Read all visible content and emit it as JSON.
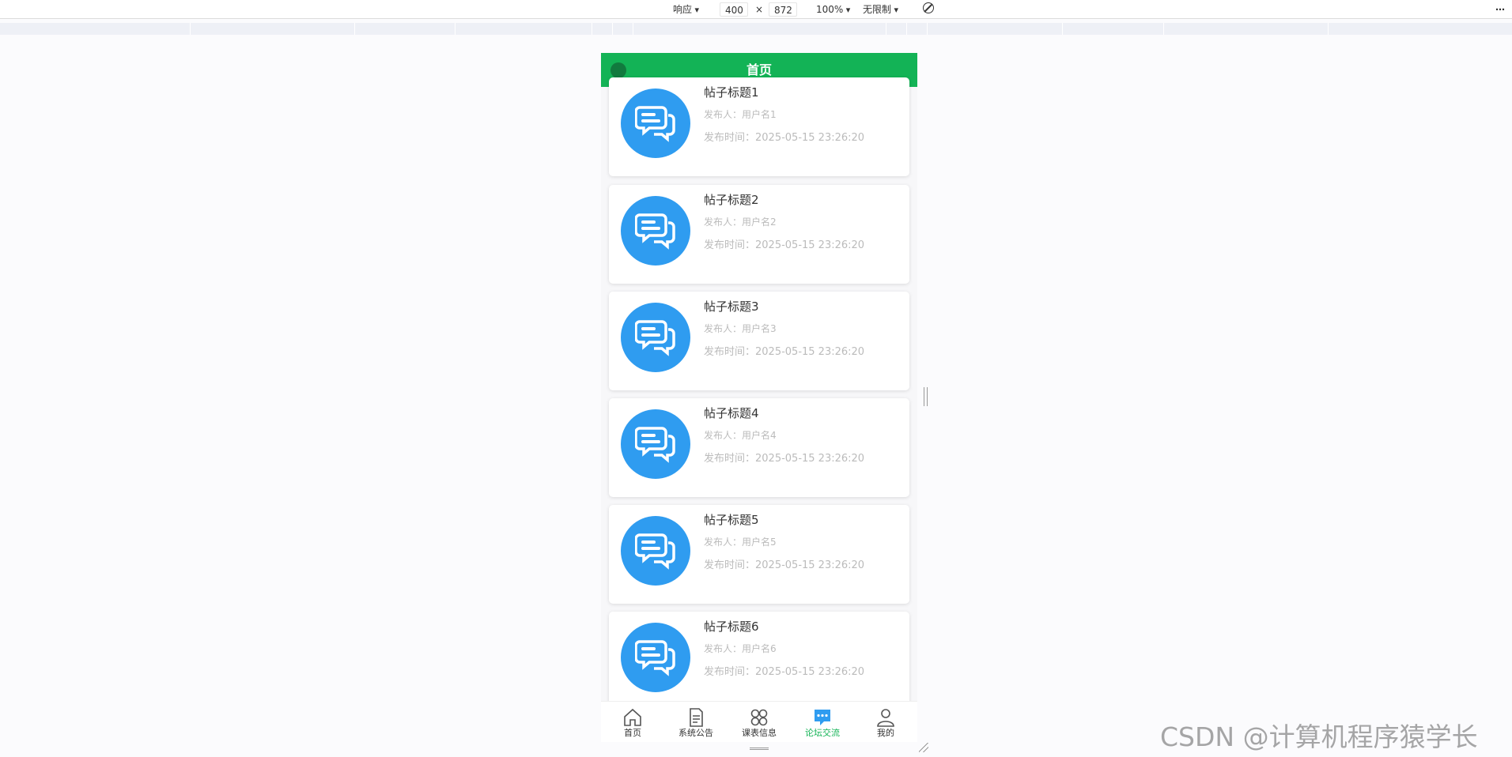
{
  "devtools": {
    "device": "响应",
    "width": "400",
    "times": "×",
    "height": "872",
    "zoom": "100%",
    "throttle": "无限制",
    "more": "⋯"
  },
  "nav": {
    "title": "首页"
  },
  "posts": [
    {
      "title": "帖子标题1",
      "author": "发布人：用户名1",
      "time": "发布时间：2025-05-15 23:26:20"
    },
    {
      "title": "帖子标题2",
      "author": "发布人：用户名2",
      "time": "发布时间：2025-05-15 23:26:20"
    },
    {
      "title": "帖子标题3",
      "author": "发布人：用户名3",
      "time": "发布时间：2025-05-15 23:26:20"
    },
    {
      "title": "帖子标题4",
      "author": "发布人：用户名4",
      "time": "发布时间：2025-05-15 23:26:20"
    },
    {
      "title": "帖子标题5",
      "author": "发布人：用户名5",
      "time": "发布时间：2025-05-15 23:26:20"
    },
    {
      "title": "帖子标题6",
      "author": "发布人：用户名6",
      "time": "发布时间：2025-05-15 23:26:20"
    }
  ],
  "tabbar": {
    "items": [
      {
        "label": "首页",
        "icon": "home-icon"
      },
      {
        "label": "系统公告",
        "icon": "document-icon"
      },
      {
        "label": "课表信息",
        "icon": "grid-icon"
      },
      {
        "label": "论坛交流",
        "icon": "chat-icon",
        "active": true
      },
      {
        "label": "我的",
        "icon": "user-icon"
      }
    ]
  },
  "colors": {
    "nav_green": "#13b356",
    "avatar_blue": "#2f9cf0",
    "active_tab": "#13b356",
    "muted_text": "#bbbbbb"
  },
  "watermark": "CSDN @计算机程序猿学长"
}
